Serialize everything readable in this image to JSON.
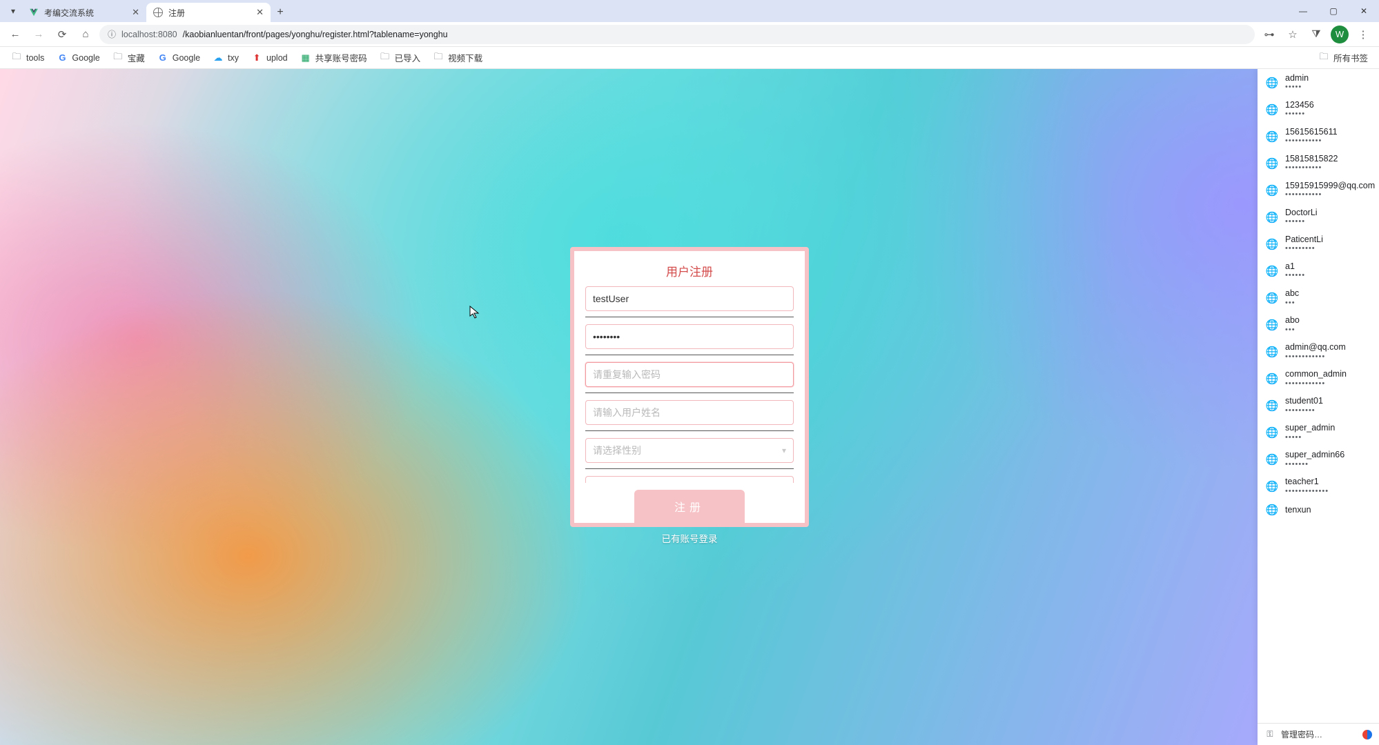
{
  "browser": {
    "tabs": [
      {
        "title": "考编交流系统",
        "active": false,
        "icon": "vue"
      },
      {
        "title": "注册",
        "active": true,
        "icon": "globe"
      }
    ],
    "window_controls": {
      "min": "—",
      "max": "▢",
      "close": "✕"
    },
    "nav": {
      "back": "←",
      "forward": "→",
      "reload": "⟳",
      "home": "⌂"
    },
    "url": {
      "scheme_icon": "ⓘ",
      "host": "localhost:8080",
      "path": "/kaobianluentan/front/pages/yonghu/register.html?tablename=yonghu"
    },
    "right_icons": {
      "password_key": "⊶",
      "star": "☆",
      "extensions": "⧩",
      "avatar_letter": "W",
      "menu": "⋮"
    },
    "bookmarks": [
      {
        "icon": "folder",
        "label": "tools"
      },
      {
        "icon": "google",
        "label": "Google"
      },
      {
        "icon": "folder",
        "label": "宝藏"
      },
      {
        "icon": "google",
        "label": "Google"
      },
      {
        "icon": "cloud",
        "label": "txy"
      },
      {
        "icon": "upload",
        "label": "uplod"
      },
      {
        "icon": "sheet",
        "label": "共享账号密码"
      },
      {
        "icon": "folder",
        "label": "已导入"
      },
      {
        "icon": "folder",
        "label": "视频下载"
      }
    ],
    "all_bookmarks_label": "所有书签"
  },
  "card": {
    "title": "用户注册",
    "username_value": "testUser",
    "password_value": "••••••••",
    "confirm_placeholder": "请重复输入密码",
    "realname_placeholder": "请输入用户姓名",
    "gender_placeholder": "请选择性别",
    "submit_label": "注册",
    "login_link_label": "已有账号登录"
  },
  "pw_suggest": {
    "items": [
      {
        "user": "admin",
        "mask": "•••••"
      },
      {
        "user": "123456",
        "mask": "••••••"
      },
      {
        "user": "15615615611",
        "mask": "•••••••••••"
      },
      {
        "user": "15815815822",
        "mask": "•••••••••••"
      },
      {
        "user": "15915915999@qq.com",
        "mask": "•••••••••••"
      },
      {
        "user": "DoctorLi",
        "mask": "••••••"
      },
      {
        "user": "PaticentLi",
        "mask": "•••••••••"
      },
      {
        "user": "a1",
        "mask": "••••••"
      },
      {
        "user": "abc",
        "mask": "•••"
      },
      {
        "user": "abo",
        "mask": "•••"
      },
      {
        "user": "admin@qq.com",
        "mask": "••••••••••••"
      },
      {
        "user": "common_admin",
        "mask": "••••••••••••"
      },
      {
        "user": "student01",
        "mask": "•••••••••"
      },
      {
        "user": "super_admin",
        "mask": "•••••"
      },
      {
        "user": "super_admin66",
        "mask": "•••••••"
      },
      {
        "user": "teacher1",
        "mask": "•••••••••••••"
      },
      {
        "user": "tenxun",
        "mask": ""
      }
    ],
    "footer_label": "管理密码…"
  }
}
